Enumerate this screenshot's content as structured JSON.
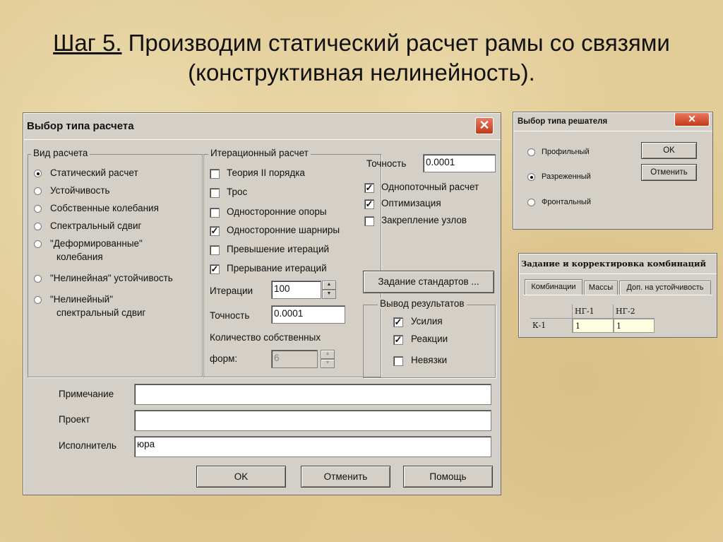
{
  "slide": {
    "title_step": "Шаг 5.",
    "title_line1": " Производим статический расчет рамы со связями",
    "title_line2": "(конструктивная нелинейность)."
  },
  "main_dialog": {
    "title": "Выбор типа расчета",
    "calc_type": {
      "label": "Вид расчета",
      "options": [
        {
          "line1": "Статический расчет",
          "selected": true
        },
        {
          "line1": "Устойчивость",
          "selected": false
        },
        {
          "line1": "Собственные колебания",
          "selected": false
        },
        {
          "line1": "Спектральный сдвиг",
          "selected": false
        },
        {
          "line1": "\"Деформированные\"",
          "line2": "колебания",
          "selected": false
        },
        {
          "line1": "\"Нелинейная\" устойчивость",
          "selected": false
        },
        {
          "line1": "\"Нелинейный\"",
          "line2": "спектральный  сдвиг",
          "selected": false
        }
      ]
    },
    "iteration": {
      "label": "Итерационный расчет",
      "checks": [
        {
          "label": "Теория II порядка",
          "checked": false
        },
        {
          "label": "Трос",
          "checked": false
        },
        {
          "label": "Односторонние опоры",
          "checked": false
        },
        {
          "label": "Односторонние шарниры",
          "checked": true
        },
        {
          "label": "Превышение итераций",
          "checked": false
        },
        {
          "label": "Прерывание итераций",
          "checked": true
        }
      ],
      "iterations_label": "Итерации",
      "iterations_value": "100",
      "accuracy_label": "Точность",
      "accuracy_value": "0.0001",
      "eigen_label_1": "Количество собственных",
      "eigen_label_2": "форм:",
      "eigen_value": "6"
    },
    "right": {
      "accuracy_label": "Точность",
      "accuracy_value": "0.0001",
      "checks": [
        {
          "label": "Однопоточный расчет",
          "checked": true
        },
        {
          "label": "Оптимизация",
          "checked": true
        },
        {
          "label": "Закрепление узлов",
          "checked": false
        }
      ],
      "standards_button": "Задание стандартов ..."
    },
    "output": {
      "label": "Вывод результатов",
      "checks": [
        {
          "label": "Усилия",
          "checked": true
        },
        {
          "label": "Реакции",
          "checked": true
        },
        {
          "label": "Невязки",
          "checked": false
        }
      ]
    },
    "note_label": "Примечание",
    "note_value": "",
    "project_label": "Проект",
    "project_value": "",
    "executor_label": "Исполнитель",
    "executor_value": "юра",
    "ok": "OK",
    "cancel": "Отменить",
    "help": "Помощь"
  },
  "solver_dialog": {
    "title": "Выбор типа решателя",
    "options": [
      {
        "label": "Профильный",
        "selected": false
      },
      {
        "label": "Разреженный",
        "selected": true
      },
      {
        "label": "Фронтальный",
        "selected": false
      }
    ],
    "ok": "OK",
    "cancel": "Отменить"
  },
  "combo_dialog": {
    "title": "Задание и корректировка комбинаций",
    "tabs": [
      "Комбинации",
      "Массы",
      "Доп. на устойчивость"
    ],
    "columns": [
      "НГ-1",
      "НГ-2"
    ],
    "rows": [
      {
        "name": "К-1",
        "values": [
          "1",
          "1"
        ]
      }
    ]
  }
}
